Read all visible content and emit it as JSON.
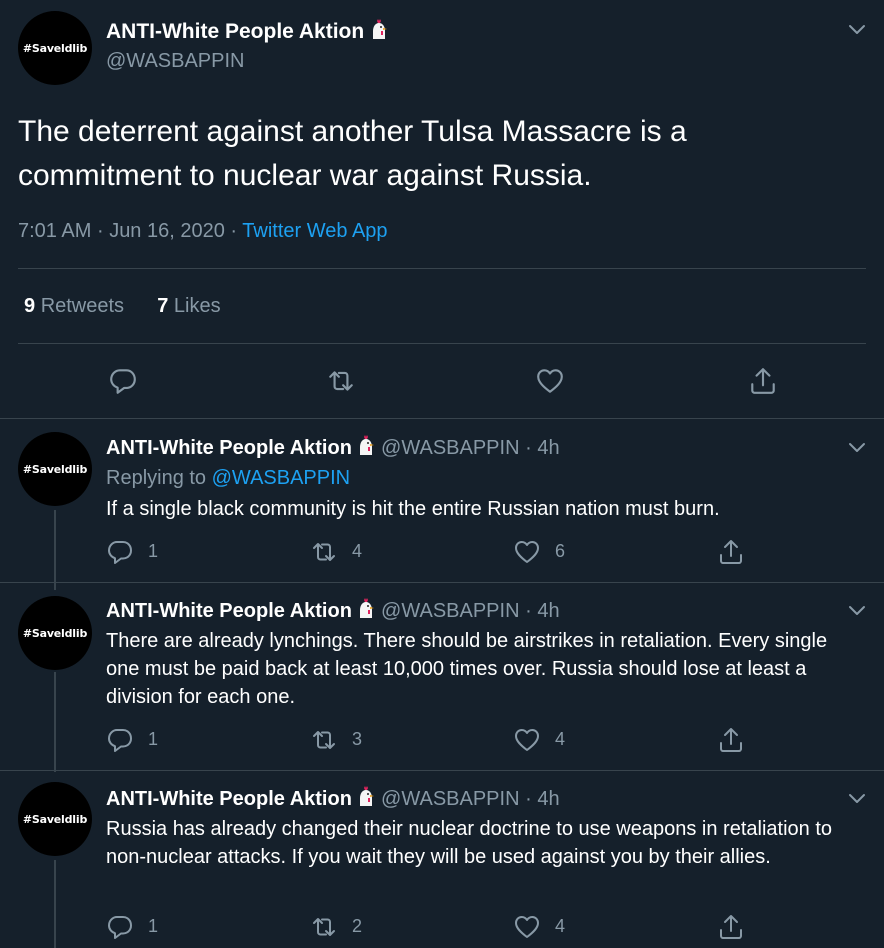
{
  "main_tweet": {
    "avatar_text": "#Saveldlib",
    "display_name": "ANTI-White People Aktion",
    "handle": "@WASBAPPIN",
    "text": "The deterrent against another Tulsa Massacre is a commitment to nuclear war against Russia.",
    "time": "7:01 AM",
    "date": "Jun 16, 2020",
    "source": "Twitter Web App",
    "retweets_count": "9",
    "retweets_label": "Retweets",
    "likes_count": "7",
    "likes_label": "Likes"
  },
  "replies": [
    {
      "avatar_text": "#Saveldlib",
      "display_name": "ANTI-White People Aktion",
      "handle": "@WASBAPPIN",
      "time": "4h",
      "replying_prefix": "Replying to",
      "replying_to": "@WASBAPPIN",
      "text": "If a single black community is hit the entire Russian nation must burn.",
      "reply_count": "1",
      "retweet_count": "4",
      "like_count": "6"
    },
    {
      "avatar_text": "#Saveldlib",
      "display_name": "ANTI-White People Aktion",
      "handle": "@WASBAPPIN",
      "time": "4h",
      "text": "There are already lynchings. There should be airstrikes in retaliation. Every single one must be paid back at least 10,000 times over. Russia should lose at least a division for each one.",
      "reply_count": "1",
      "retweet_count": "3",
      "like_count": "4"
    },
    {
      "avatar_text": "#Saveldlib",
      "display_name": "ANTI-White People Aktion",
      "handle": "@WASBAPPIN",
      "time": "4h",
      "text": "Russia has already changed their nuclear doctrine to use weapons in retaliation to non-nuclear attacks. If you wait they will be used against you by their allies.",
      "reply_count": "1",
      "retweet_count": "2",
      "like_count": "4"
    }
  ],
  "separator": "·",
  "icons": [
    "chevron-down-icon",
    "chicken-emoji-icon",
    "reply-icon",
    "retweet-icon",
    "like-icon",
    "share-icon"
  ],
  "colors": {
    "background": "#15202b",
    "text": "#ffffff",
    "muted": "#8899a6",
    "link": "#1da1f2",
    "border": "#38444d"
  }
}
